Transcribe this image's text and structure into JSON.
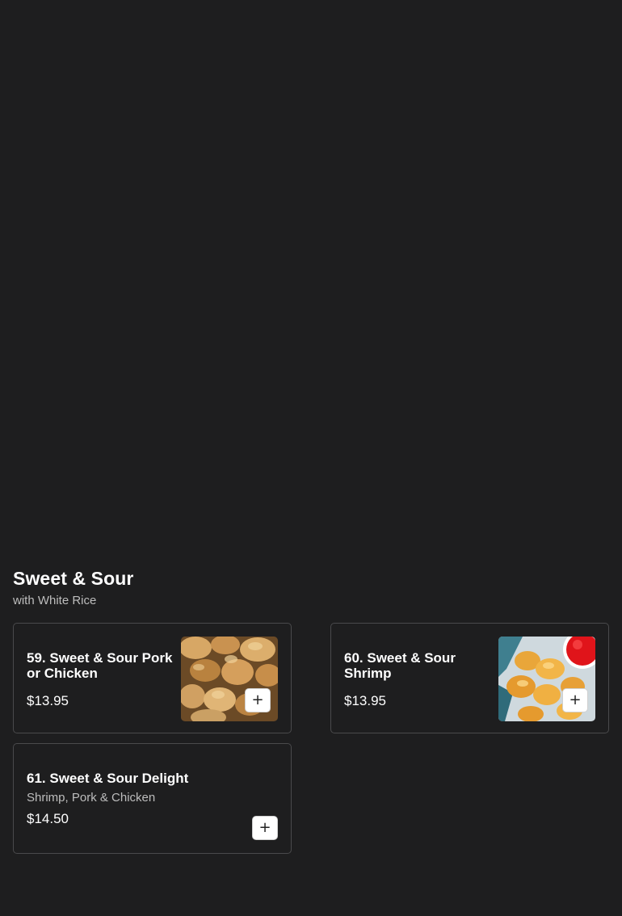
{
  "section": {
    "title": "Sweet & Sour",
    "subtitle": "with White Rice"
  },
  "items": [
    {
      "name": "59. Sweet & Sour Pork or Chicken",
      "price": "$13.95",
      "image_icon": "sweet-sour-pork-photo",
      "add_label": "+"
    },
    {
      "name": "60. Sweet & Sour Shrimp",
      "price": "$13.95",
      "image_icon": "sweet-sour-shrimp-photo",
      "add_label": "+"
    },
    {
      "name": "61. Sweet & Sour Delight",
      "description": "Shrimp, Pork & Chicken",
      "price": "$14.50",
      "add_label": "+"
    }
  ],
  "colors": {
    "background": "#1e1e1f",
    "card_border": "#4a4a4c",
    "text": "#ffffff",
    "muted_text": "#bdbdbd"
  }
}
